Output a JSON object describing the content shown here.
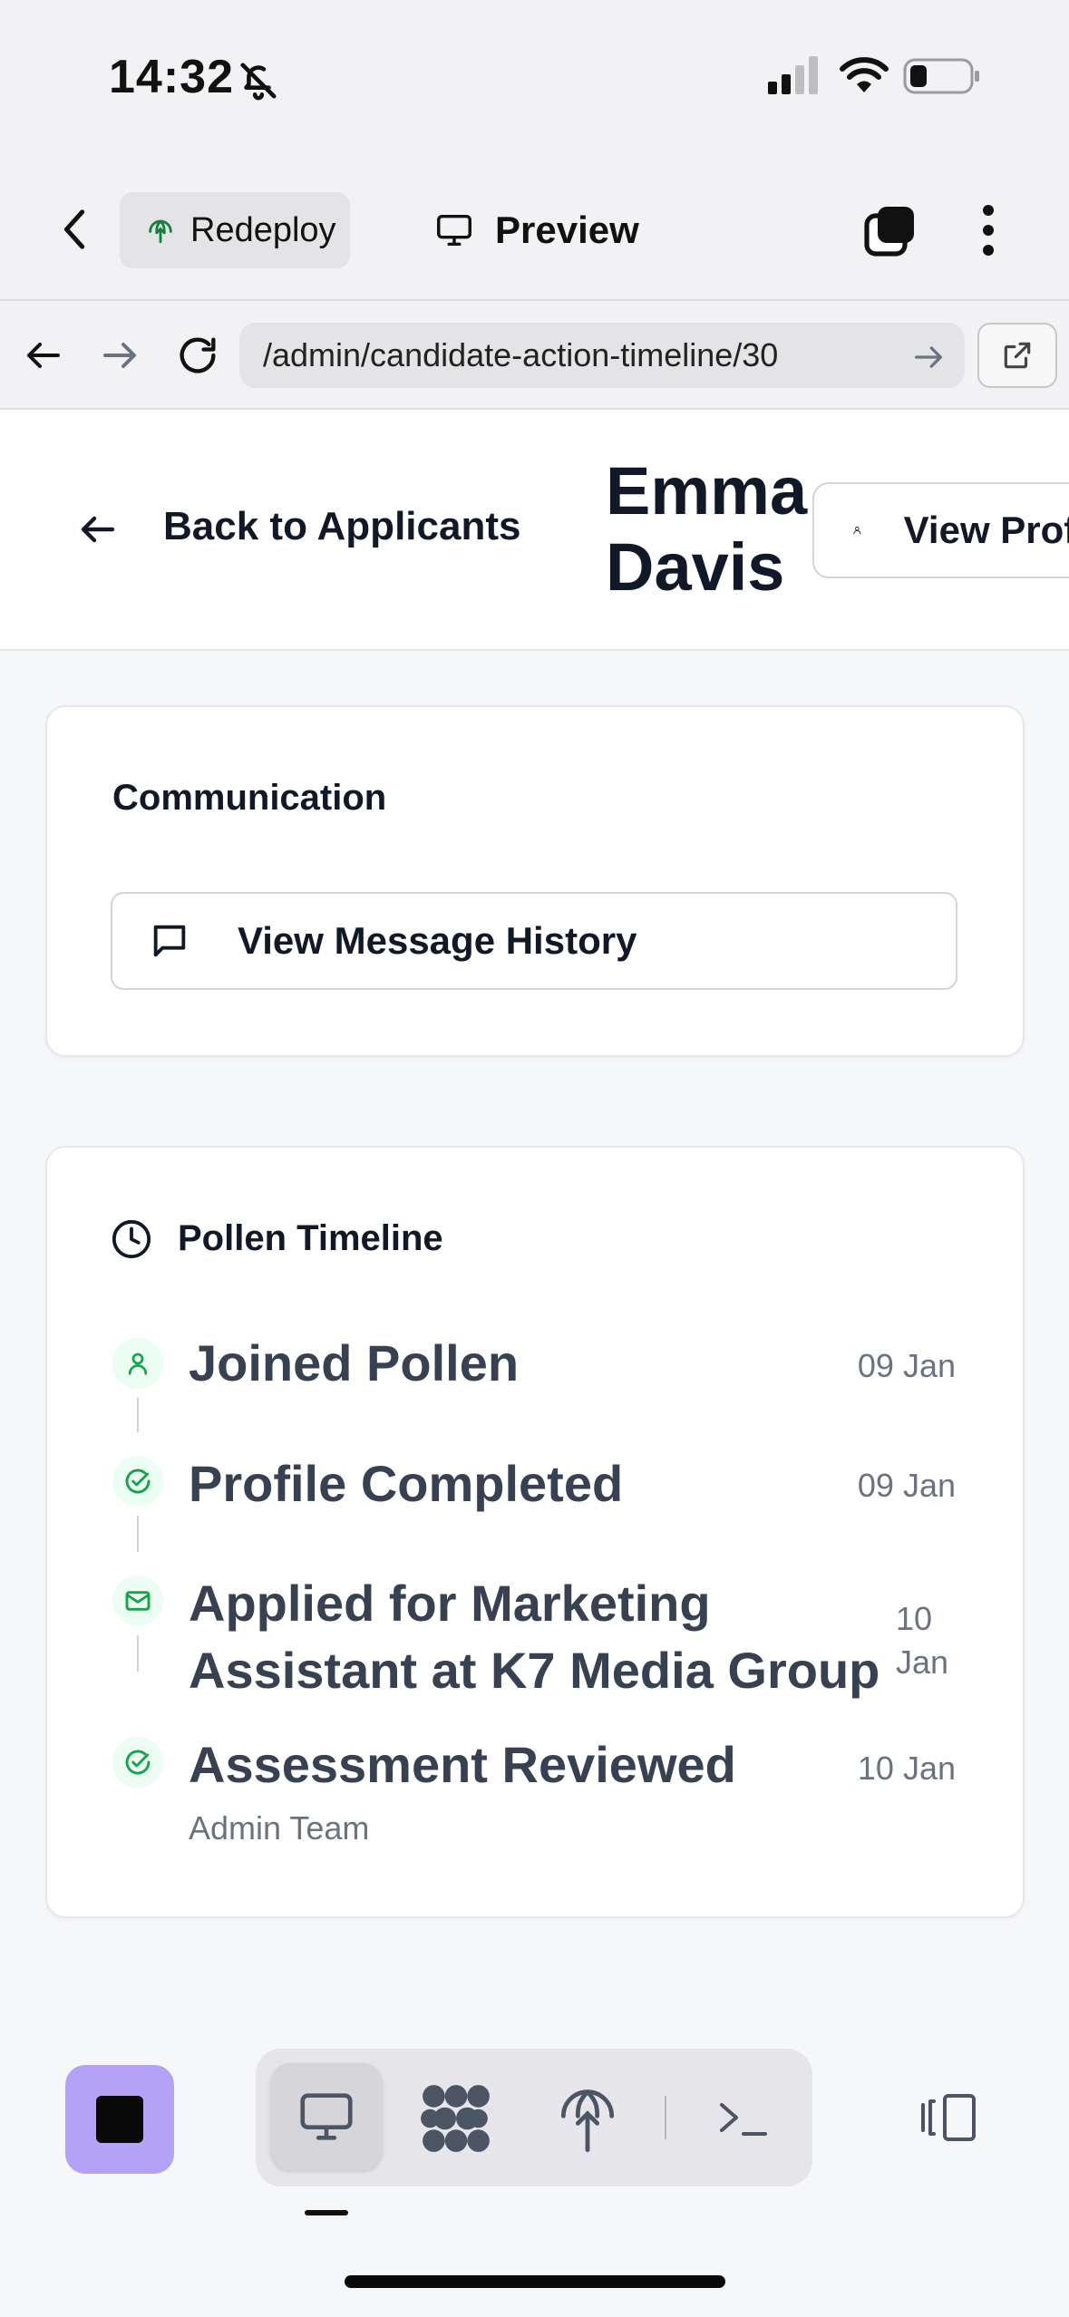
{
  "status_bar": {
    "time": "14:32",
    "icons": [
      "bell-slash-icon",
      "cellular-signal-icon",
      "wifi-icon",
      "battery-icon"
    ]
  },
  "toolbar": {
    "redeploy_label": "Redeploy",
    "preview_label": "Preview",
    "icons": [
      "back-chevron-icon",
      "globe-deploy-icon",
      "monitor-icon",
      "tabs-icon",
      "more-vertical-icon"
    ]
  },
  "browser": {
    "url": "/admin/candidate-action-timeline/30",
    "icons": [
      "arrow-left-icon",
      "arrow-right-icon",
      "reload-icon",
      "arrow-right-small-icon",
      "external-link-icon"
    ]
  },
  "header": {
    "back_label": "Back to Applicants",
    "candidate_name": "Emma Davis",
    "view_profile_label": "View Profile"
  },
  "communication": {
    "title": "Communication",
    "message_history_label": "View Message History"
  },
  "timeline": {
    "title": "Pollen Timeline",
    "events": [
      {
        "title": "Joined Pollen",
        "date": "09 Jan",
        "icon": "user-icon"
      },
      {
        "title": "Profile Completed",
        "date": "09 Jan",
        "icon": "check-circle-icon"
      },
      {
        "title": "Applied for Marketing Assistant at K7 Media Group",
        "date": "10 Jan",
        "icon": "mail-icon"
      },
      {
        "title": "Assessment Reviewed",
        "date": "10 Jan",
        "subtitle": "Admin Team",
        "icon": "check-circle-icon"
      }
    ]
  },
  "dock": {
    "accent": "#b4a2f6",
    "icons": [
      "stop-icon",
      "monitor-icon",
      "bees-icon",
      "deploy-icon",
      "terminal-icon",
      "side-panel-icon"
    ]
  }
}
